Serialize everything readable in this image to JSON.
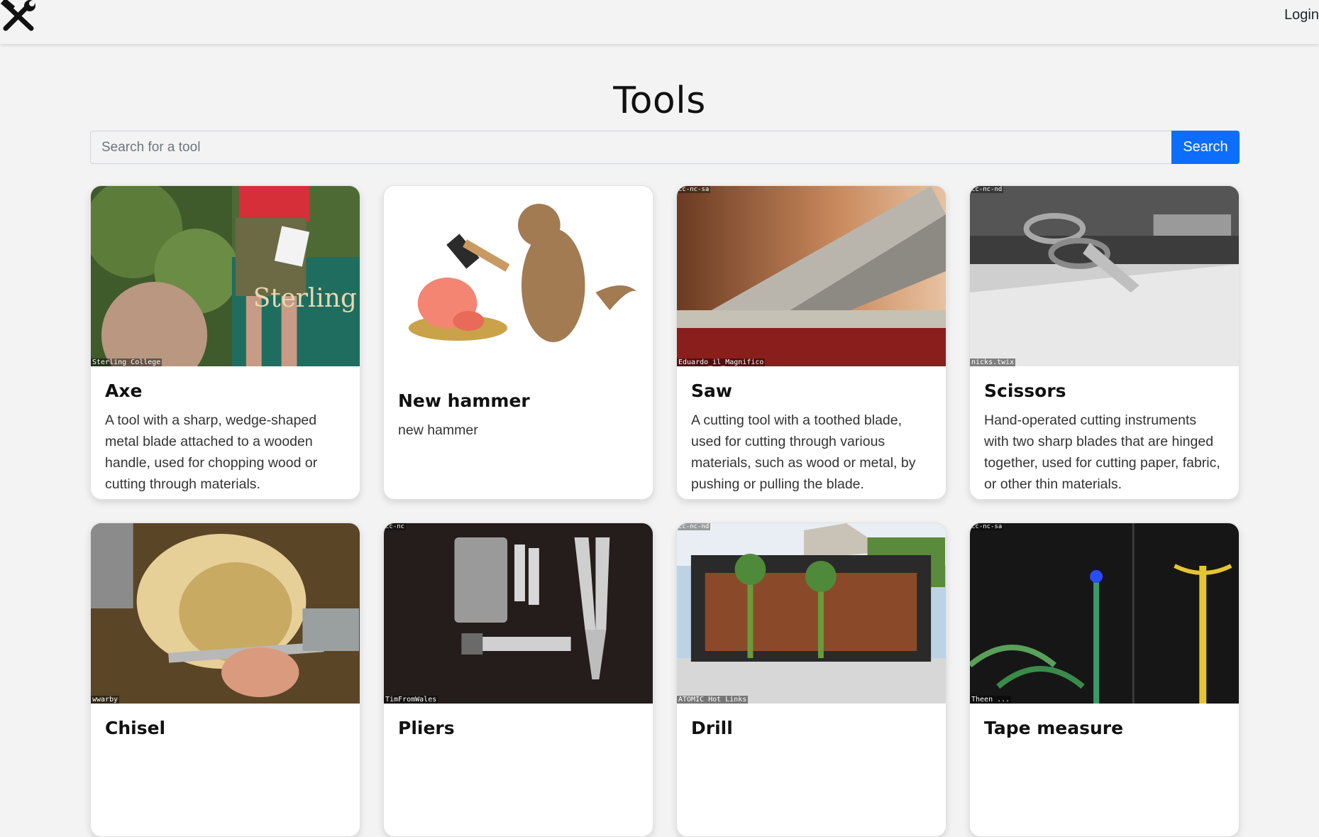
{
  "nav": {
    "logo_icon": "hammer-wrench-icon",
    "login_label": "Login"
  },
  "page": {
    "title": "Tools"
  },
  "search": {
    "placeholder": "Search for a tool",
    "button_label": "Search",
    "button_color": "#0d6efd"
  },
  "tools": [
    {
      "name": "Axe",
      "description": "A tool with a sharp, wedge-shaped metal blade attached to a wooden handle, used for chopping wood or cutting through materials.",
      "image_credit": "Sterling College",
      "image_license": ""
    },
    {
      "name": "New hammer",
      "description": "new hammer",
      "image_credit": "",
      "image_license": ""
    },
    {
      "name": "Saw",
      "description": "A cutting tool with a toothed blade, used for cutting through various materials, such as wood or metal, by pushing or pulling the blade.",
      "image_credit": "Eduardo_il_Magnifico",
      "image_license": "cc-nc-sa"
    },
    {
      "name": "Scissors",
      "description": "Hand-operated cutting instruments with two sharp blades that are hinged together, used for cutting paper, fabric, or other thin materials.",
      "image_credit": "nicks.twix",
      "image_license": "cc-nc-nd"
    },
    {
      "name": "Chisel",
      "description": "",
      "image_credit": "wwarby",
      "image_license": ""
    },
    {
      "name": "Pliers",
      "description": "",
      "image_credit": "TimFromWales",
      "image_license": "cc-nc"
    },
    {
      "name": "Drill",
      "description": "",
      "image_credit": "ATOMIC Hot Links",
      "image_license": "cc-nc-nd"
    },
    {
      "name": "Tape measure",
      "description": "",
      "image_credit": "Theen ...",
      "image_license": "cc-nc-sa"
    }
  ]
}
